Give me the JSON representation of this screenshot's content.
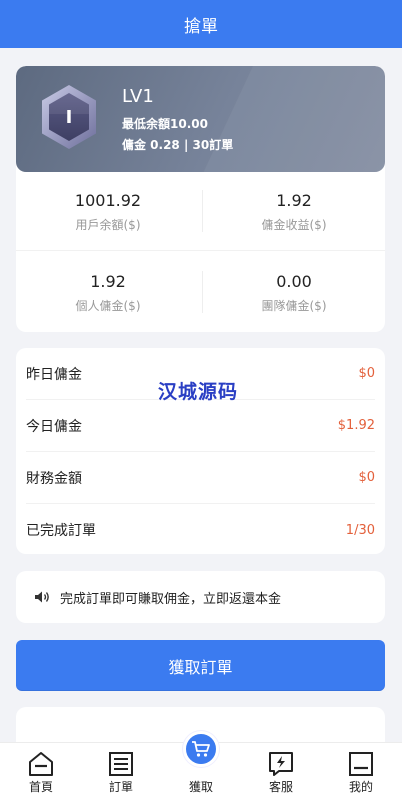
{
  "header": {
    "title": "搶單"
  },
  "level": {
    "name": "LV1",
    "badge_letter": "I",
    "min_balance": "最低余額10.00",
    "commission_info": "傭金 0.28 | 30訂單"
  },
  "stats": [
    {
      "value": "1001.92",
      "label": "用戶余額($)"
    },
    {
      "value": "1.92",
      "label": "傭金收益($)"
    },
    {
      "value": "1.92",
      "label": "個人傭金($)"
    },
    {
      "value": "0.00",
      "label": "團隊傭金($)"
    }
  ],
  "commission_rows": [
    {
      "label": "昨日傭金",
      "value": "$0"
    },
    {
      "label": "今日傭金",
      "value": "$1.92"
    },
    {
      "label": "財務金額",
      "value": "$0"
    },
    {
      "label": "已完成訂單",
      "value": "1/30"
    }
  ],
  "watermark": "汉城源码",
  "notice": {
    "icon": "speaker-icon",
    "text": "完成訂單即可賺取佣金，立即返還本金"
  },
  "grab_button": {
    "label": "獲取訂單"
  },
  "tabs": [
    {
      "label": "首頁",
      "icon": "home-icon"
    },
    {
      "label": "訂單",
      "icon": "orders-icon"
    },
    {
      "label": "獲取",
      "icon": "cart-icon"
    },
    {
      "label": "客服",
      "icon": "service-icon"
    },
    {
      "label": "我的",
      "icon": "profile-icon"
    }
  ],
  "colors": {
    "primary": "#3b7bf0",
    "accent_value": "#e3603b",
    "level_card": "#6f7b90"
  }
}
